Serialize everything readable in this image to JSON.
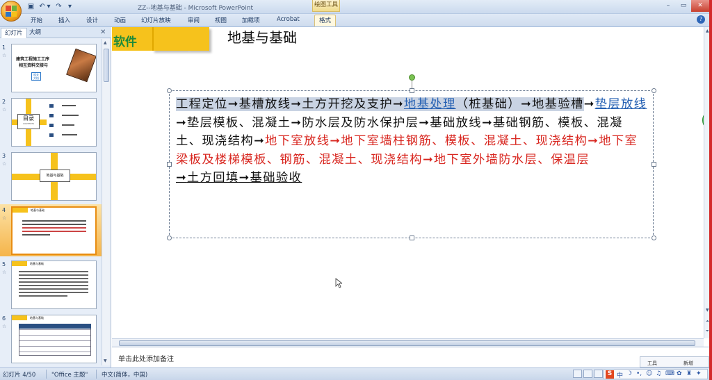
{
  "window": {
    "title": "ZZ--地基与基础 - Microsoft PowerPoint",
    "context_group": "绘图工具"
  },
  "ribbon": {
    "tabs": [
      "开始",
      "插入",
      "设计",
      "动画",
      "幻灯片放映",
      "审阅",
      "视图",
      "加载项",
      "Acrobat"
    ],
    "context_tab": "格式"
  },
  "left_pane": {
    "tab_slides": "幻灯片",
    "tab_outline": "大纲",
    "slides": [
      {
        "num": "1",
        "title_lines": [
          "建筑工程施工工序",
          "相互资料交接与"
        ],
        "badge": "相关 文档"
      },
      {
        "num": "2",
        "title": "目录",
        "sub": "CONTENTS"
      },
      {
        "num": "3",
        "title": "地基与基础"
      },
      {
        "num": "4",
        "title": "地基与基础"
      },
      {
        "num": "5",
        "title": "地基与基础"
      },
      {
        "num": "6",
        "title": "地基与基础"
      }
    ]
  },
  "slide": {
    "header_label": "软件",
    "title": "地基与基础",
    "body": {
      "s1": "工程定位",
      "a": "➞",
      "s2": "基槽放线",
      "s3": "土方开挖及支护",
      "s4": "地基处理",
      "s5": "（桩基础）",
      "s6": "地基验槽",
      "s7": "垫层放线",
      "s8": "垫层模板、混凝土",
      "s9": "防水层及防水保护层",
      "s10": "基础放线",
      "s11": "基础钢筋、模板、混凝土、现浇结构",
      "s12": "地下室放线",
      "s13": "地下室墙柱钢筋、模板、混凝土、现浇结构",
      "s14": "地下室梁板及楼梯模板、钢筋、混凝土、现浇结构",
      "s15": "地下室外墙防水层、保温层",
      "s16": "土方回填",
      "s17": "基础验收"
    }
  },
  "notes": {
    "placeholder": "单击此处添加备注",
    "popup_left": "工具",
    "popup_right": "新增"
  },
  "side_widget": "77",
  "statusbar": {
    "slide_info": "幻灯片 4/50",
    "theme": "\"Office 主题\"",
    "language": "中文(简体，中国)",
    "ime_logo": "S",
    "ime_mode": "中"
  },
  "colors": {
    "accent_yellow": "#f6c21c",
    "link_blue": "#2661b3",
    "text_red": "#d8261f",
    "selection_orange": "#f5b44a"
  }
}
